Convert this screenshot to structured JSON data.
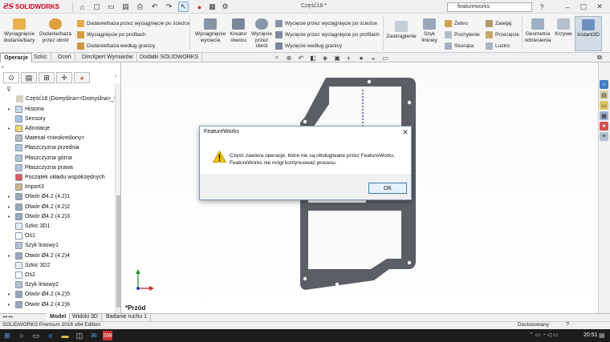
{
  "app": {
    "brand": "SOLIDWORKS",
    "document_title": "Część18 *"
  },
  "search": {
    "value": "featureworks"
  },
  "ribbon": {
    "big_buttons": [
      {
        "label": "Wyciągnięcie dodania/bazy",
        "icon": "extrude-boss-icon"
      },
      {
        "label": "Dodanie/baza przez obrót",
        "icon": "revolve-boss-icon"
      },
      {
        "label": "Wyciągnięcie wycięcia",
        "icon": "extruded-cut-icon"
      },
      {
        "label": "Kreator otworu",
        "icon": "hole-wizard-icon"
      },
      {
        "label": "Wycięcie przez obrót",
        "icon": "revolved-cut-icon"
      },
      {
        "label": "Zaokrąglenie",
        "icon": "fillet-icon"
      },
      {
        "label": "Szyk liniowy",
        "icon": "linear-pattern-icon"
      },
      {
        "label": "Geometria odniesienia",
        "icon": "reference-geometry-icon"
      },
      {
        "label": "Krzywe",
        "icon": "curves-icon"
      },
      {
        "label": "Instant3D",
        "icon": "instant3d-icon"
      }
    ],
    "small_group1": [
      "Dodanie/baza przez wyciągnięcie po ścieżce",
      "Wyciągnięcie po profilach",
      "Dodanie/baza według granicy"
    ],
    "small_group2": [
      "Wycięcie przez wyciągnięcie po ścieżce",
      "Wycięcie przez wyciągnięcie po profilach",
      "Wycięcie według granicy"
    ],
    "small_group3": [
      "Żebro",
      "Pochylenie",
      "Skorupa"
    ],
    "small_group4": [
      "Zawijaj",
      "Przecięcie",
      "Lustro"
    ]
  },
  "command_tabs": [
    "Operacje",
    "Szkic",
    "Oceń",
    "DimXpert Wymiarów",
    "Dodatki SOLIDWORKS"
  ],
  "tree": {
    "root": "Część18  (Domyślna<<Domyślna>_St",
    "items": [
      {
        "label": "Historia",
        "icon": "history-icon",
        "expand": true
      },
      {
        "label": "Sensory",
        "icon": "sensor-icon",
        "expand": false
      },
      {
        "label": "Adnotacje",
        "icon": "annotation-icon",
        "expand": true
      },
      {
        "label": "Materiał <nieokreślony>",
        "icon": "material-icon",
        "expand": false
      },
      {
        "label": "Płaszczyzna przednia",
        "icon": "plane-icon",
        "expand": false
      },
      {
        "label": "Płaszczyzna górna",
        "icon": "plane-icon",
        "expand": false
      },
      {
        "label": "Płaszczyzna prawa",
        "icon": "plane-icon",
        "expand": false
      },
      {
        "label": "Początek układu współrzędnych",
        "icon": "origin-icon",
        "expand": false
      },
      {
        "label": "Import3",
        "icon": "import-icon",
        "expand": false
      },
      {
        "label": "Otwór Ø4.2 (4.2)1",
        "icon": "hole-icon",
        "expand": true
      },
      {
        "label": "Otwór Ø4.2 (4.2)2",
        "icon": "hole-icon",
        "expand": true
      },
      {
        "label": "Otwór Ø4.2 (4.2)3",
        "icon": "hole-icon",
        "expand": true
      },
      {
        "label": "Szkic 3D1",
        "icon": "sketch3d-icon",
        "expand": false
      },
      {
        "label": "Oś1",
        "icon": "axis-icon",
        "expand": false
      },
      {
        "label": "Szyk liniowy1",
        "icon": "pattern-icon",
        "expand": false
      },
      {
        "label": "Otwór Ø4.2 (4.2)4",
        "icon": "hole-icon",
        "expand": true
      },
      {
        "label": "Szkic 3D2",
        "icon": "sketch3d-icon",
        "expand": false
      },
      {
        "label": "Oś2",
        "icon": "axis-icon",
        "expand": false
      },
      {
        "label": "Szyk liniowy2",
        "icon": "pattern-icon",
        "expand": false
      },
      {
        "label": "Otwór Ø4.2 (4.2)5",
        "icon": "hole-icon",
        "expand": true
      },
      {
        "label": "Otwór Ø4.2 (4.2)6",
        "icon": "hole-icon",
        "expand": true
      }
    ]
  },
  "view_label": "*Przód",
  "bottom_tabs": [
    "Model",
    "Widoki 3D",
    "Badanie ruchu 1"
  ],
  "status": {
    "left": "SOLIDWORKS Premium 2016 x64 Edition",
    "right": "Dostosowany"
  },
  "clock": "20:51",
  "dialog": {
    "title": "FeatureWorks",
    "message": "Część zawiera operacje, które nie są obsługiwane przez FeatureWorks. FeatureWorks nie mógł kontynuować procesu.",
    "ok_label": "OK"
  },
  "colors": {
    "accent": "#d6001c",
    "part": "#55585e",
    "dialog_border": "#7f9db9"
  }
}
